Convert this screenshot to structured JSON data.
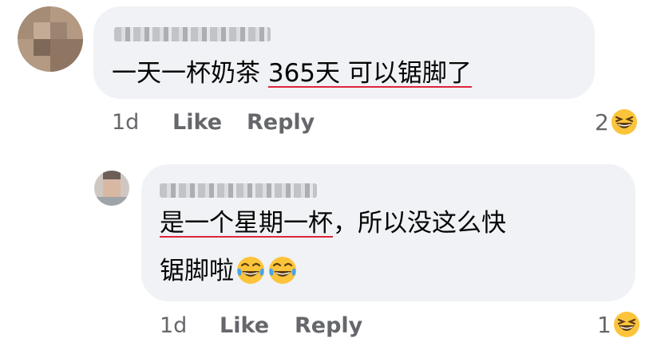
{
  "colors": {
    "bubble_bg": "#f0f2f5",
    "underline": "#e0243a",
    "meta_text": "#65676b",
    "emoji_yellow": "#fcc43b"
  },
  "comment": {
    "name_redacted": true,
    "text_prefix": "一天一杯奶茶 ",
    "text_underlined": "365天 可以锯脚了",
    "time": "1d",
    "like_label": "Like",
    "reply_label": "Reply",
    "reaction_count": "2",
    "reaction_icon": "laughing-squint-emoji"
  },
  "reply": {
    "name_redacted": true,
    "text_line1_underlined": "是一个星期一杯",
    "text_line1_rest": "，所以没这么快",
    "text_line2": "锯脚啦",
    "inline_emojis": [
      "tears-of-joy-emoji",
      "tears-of-joy-emoji"
    ],
    "time": "1d",
    "like_label": "Like",
    "reply_label": "Reply",
    "reaction_count": "1",
    "reaction_icon": "laughing-squint-emoji"
  }
}
